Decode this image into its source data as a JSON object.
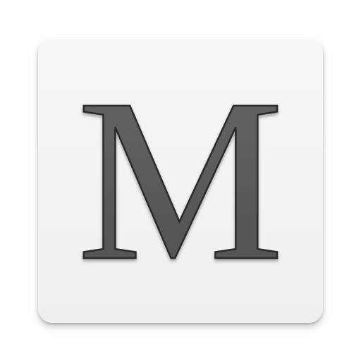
{
  "app_icon": {
    "letter": "M",
    "icon_name": "letter-m-app-icon",
    "colors": {
      "tile_background": "#f2f2f2",
      "letter_fill": "#595959",
      "letter_outline": "#2b2b2b"
    }
  }
}
